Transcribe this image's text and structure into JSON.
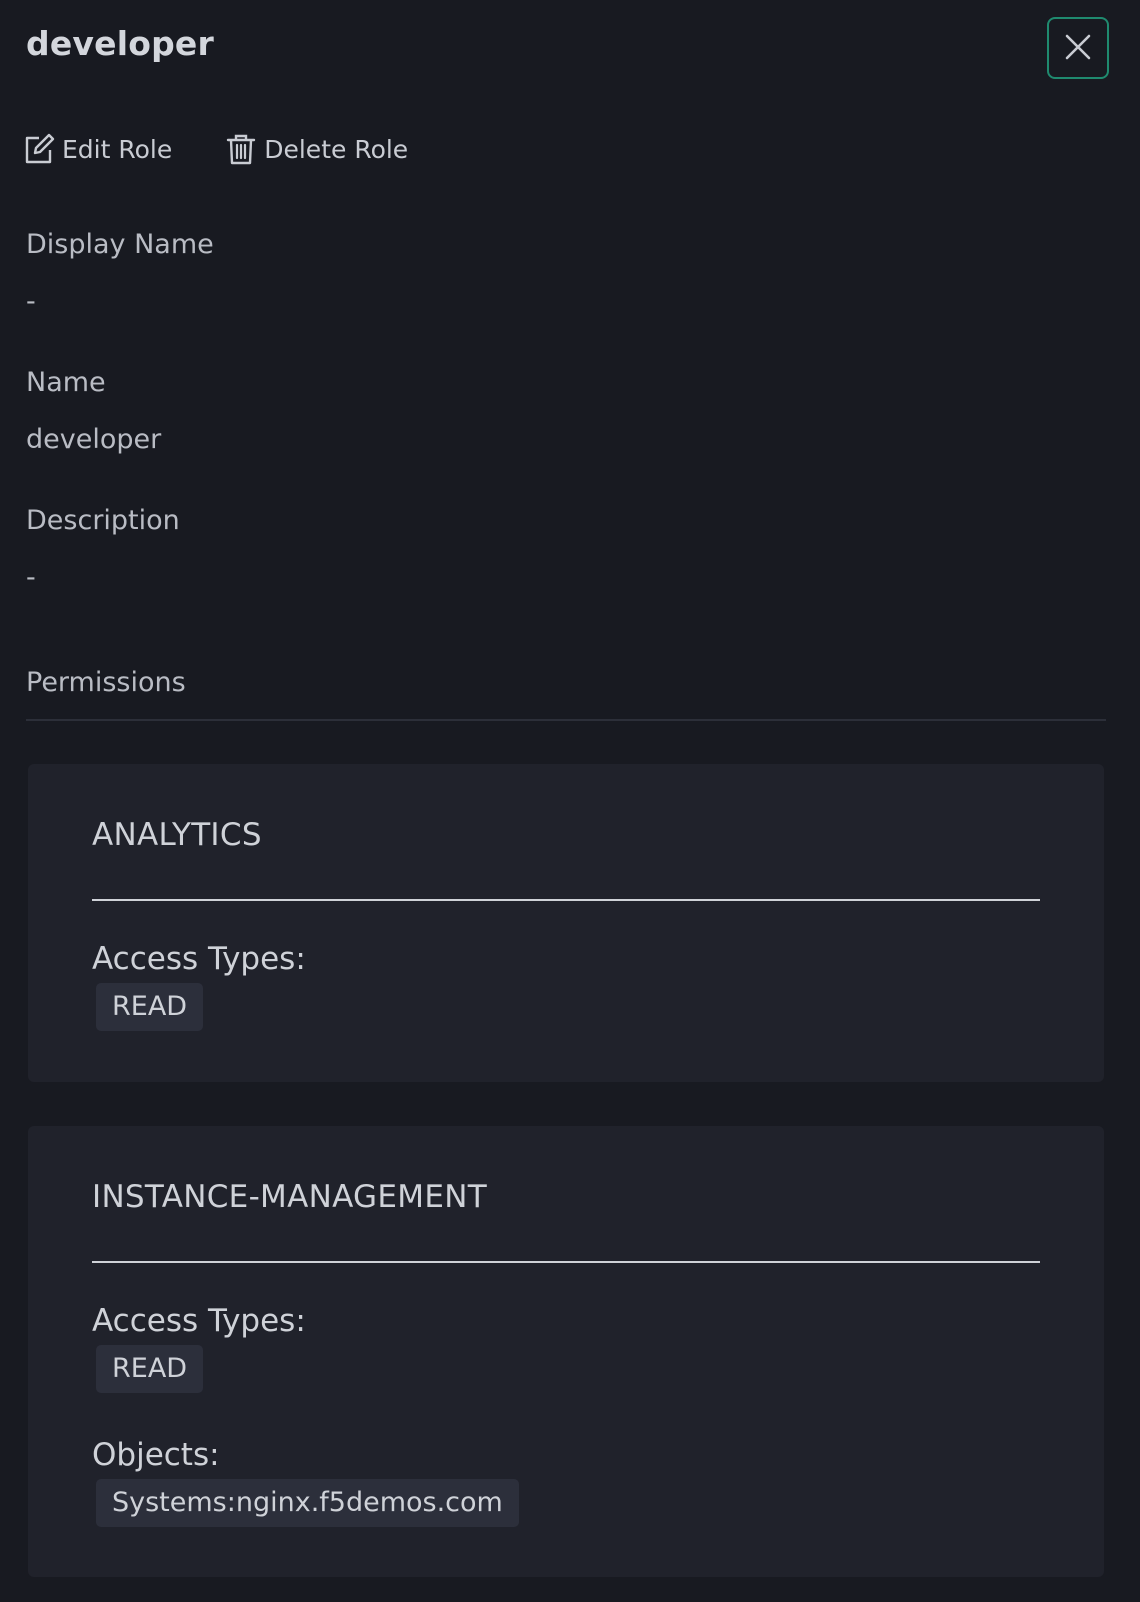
{
  "header": {
    "title": "developer",
    "close_icon": "close-icon"
  },
  "actions": {
    "edit_label": "Edit Role",
    "edit_icon": "edit-icon",
    "delete_label": "Delete Role",
    "delete_icon": "trash-icon"
  },
  "details": {
    "display_name_label": "Display Name",
    "display_name_value": "-",
    "name_label": "Name",
    "name_value": "developer",
    "description_label": "Description",
    "description_value": "-",
    "permissions_label": "Permissions"
  },
  "permissions": [
    {
      "title": "ANALYTICS",
      "access_label": "Access Types:",
      "access_types": [
        "READ"
      ]
    },
    {
      "title": "INSTANCE-MANAGEMENT",
      "access_label": "Access Types:",
      "access_types": [
        "READ"
      ],
      "objects_label": "Objects:",
      "objects": [
        "Systems:nginx.f5demos.com"
      ]
    }
  ],
  "colors": {
    "background": "#181a21",
    "card": "#20222b",
    "accent": "#1f8a6f",
    "chip": "#2c2f3b"
  }
}
